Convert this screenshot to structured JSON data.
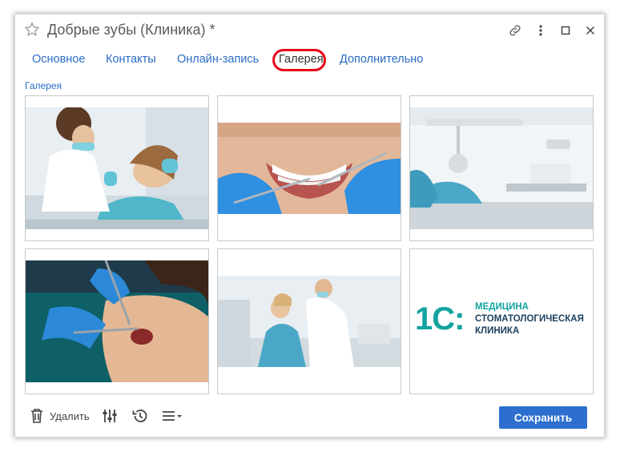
{
  "window": {
    "title": "Добрые зубы (Клиника) *",
    "icons": [
      "star-icon",
      "link-icon",
      "more-vertical-icon",
      "maximize-icon",
      "close-icon"
    ]
  },
  "tabs": [
    {
      "label": "Основное"
    },
    {
      "label": "Контакты"
    },
    {
      "label": "Онлайн-запись"
    },
    {
      "label": "Галерея",
      "active": true
    },
    {
      "label": "Дополнительно"
    }
  ],
  "gallery": {
    "label": "Галерея",
    "logo": {
      "mark": "1С:",
      "line1": "МЕДИЦИНА",
      "line2": "СТОМАТОЛОГИЧЕСКАЯ",
      "line3": "КЛИНИКА"
    }
  },
  "toolbar": {
    "delete_label": "Удалить",
    "save_label": "Сохранить",
    "icons": [
      "trash-icon",
      "settings-sliders-icon",
      "history-icon",
      "menu-icon"
    ]
  },
  "colors": {
    "accent": "#2d6fcf",
    "link": "#2a6cc4",
    "highlight": "#e8001a",
    "logo_teal": "#13a3a0"
  }
}
